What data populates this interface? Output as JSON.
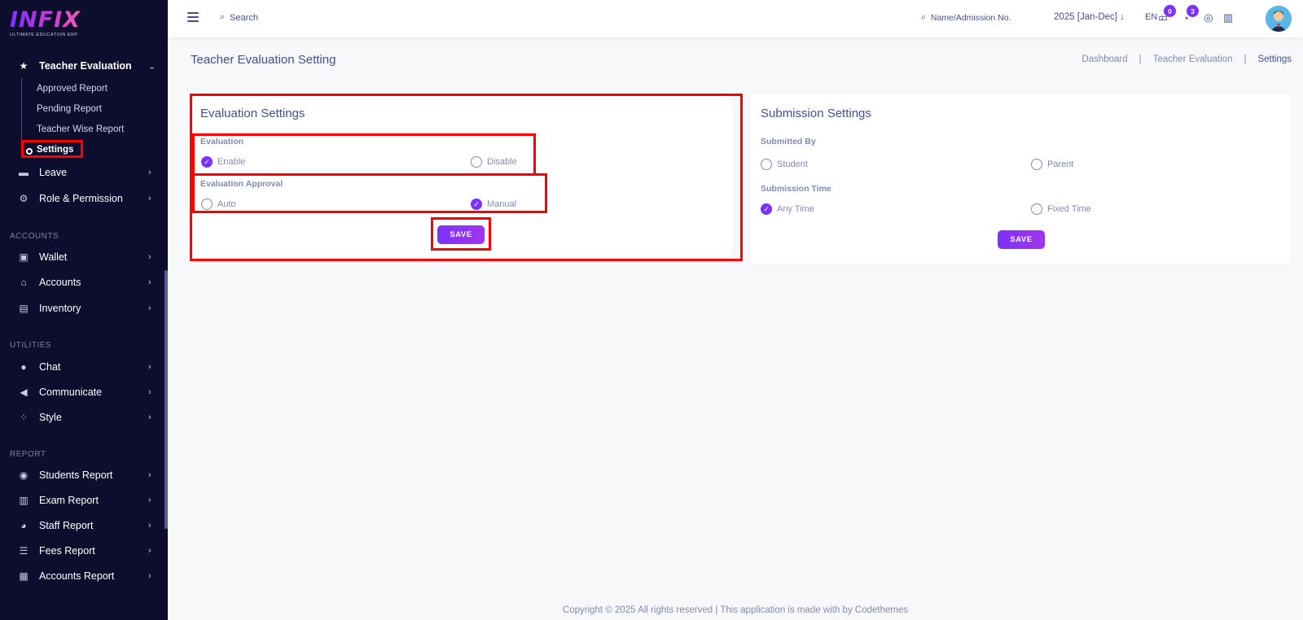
{
  "logo": {
    "brand": "INFIX",
    "tagline": "ULTIMATE EDUCATION ERP"
  },
  "sidebar": {
    "active_menu": {
      "label": "Teacher Evaluation",
      "icon": "star-icon"
    },
    "submenu": [
      {
        "label": "Approved Report"
      },
      {
        "label": "Pending Report"
      },
      {
        "label": "Teacher Wise Report"
      },
      {
        "label": "Settings"
      }
    ],
    "menu_top": [
      {
        "label": "Leave",
        "icon": "leave-icon"
      },
      {
        "label": "Role & Permission",
        "icon": "role-icon"
      }
    ],
    "sections": {
      "accounts": "ACCOUNTS",
      "utilities": "UTILITIES",
      "report": "REPORT"
    },
    "accounts_items": [
      {
        "label": "Wallet",
        "icon": "wallet-icon"
      },
      {
        "label": "Accounts",
        "icon": "bank-icon"
      },
      {
        "label": "Inventory",
        "icon": "inventory-icon"
      }
    ],
    "utilities_items": [
      {
        "label": "Chat",
        "icon": "chat-icon"
      },
      {
        "label": "Communicate",
        "icon": "megaphone-icon"
      },
      {
        "label": "Style",
        "icon": "style-icon"
      }
    ],
    "report_items": [
      {
        "label": "Students Report",
        "icon": "users-icon"
      },
      {
        "label": "Exam Report",
        "icon": "exam-icon"
      },
      {
        "label": "Staff Report",
        "icon": "staff-icon"
      },
      {
        "label": "Fees Report",
        "icon": "fees-icon"
      },
      {
        "label": "Accounts Report",
        "icon": "accounts-report-icon"
      }
    ]
  },
  "topbar": {
    "search_placeholder": "Search",
    "admission_placeholder": "Name/Admission No.",
    "year": "2025 [Jan-Dec]",
    "language": "EN",
    "messages_count": "0",
    "notifications_count": "3"
  },
  "page": {
    "title": "Teacher Evaluation Setting",
    "breadcrumb": [
      "Dashboard",
      "Teacher Evaluation",
      "Settings"
    ]
  },
  "evaluation_settings": {
    "title": "Evaluation Settings",
    "evaluation_label": "Evaluation",
    "evaluation_options": [
      "Enable",
      "Disable"
    ],
    "evaluation_selected": "Enable",
    "approval_label": "Evaluation Approval",
    "approval_options": [
      "Auto",
      "Manual"
    ],
    "approval_selected": "Manual",
    "save_label": "SAVE"
  },
  "submission_settings": {
    "title": "Submission Settings",
    "submitted_by_label": "Submitted By",
    "submitted_by_options": [
      "Student",
      "Parent"
    ],
    "submission_time_label": "Submission Time",
    "submission_time_options": [
      "Any Time",
      "Fixed Time"
    ],
    "submission_time_selected": "Any Time",
    "save_label": "SAVE"
  },
  "footer": {
    "text": "Copyright © 2025 All rights reserved | This application is made with by Codethemes"
  },
  "colors": {
    "accent": "#7c32ff",
    "sidebar_bg": "#0d0e2e",
    "text": "#415094",
    "highlight": "#ff0000"
  }
}
